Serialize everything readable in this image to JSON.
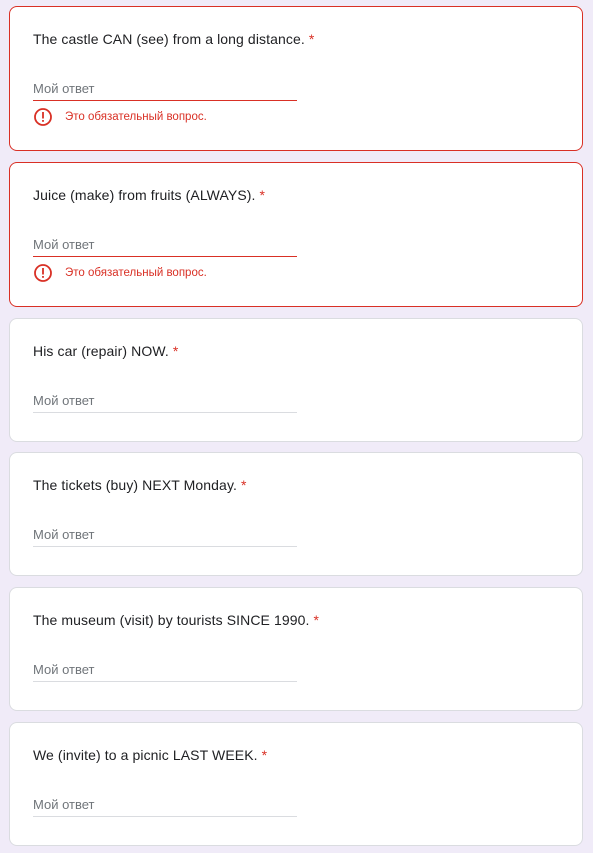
{
  "questions": [
    {
      "title": "The castle CAN (see) from a long distance.",
      "required_mark": "*",
      "placeholder": "Мой ответ",
      "error": "Это обязательный вопрос."
    },
    {
      "title": "Juice (make) from fruits (ALWAYS).",
      "required_mark": "*",
      "placeholder": "Мой ответ",
      "error": "Это обязательный вопрос."
    },
    {
      "title": "His car (repair) NOW.",
      "required_mark": "*",
      "placeholder": "Мой ответ"
    },
    {
      "title": "The tickets (buy) NEXT Monday.",
      "required_mark": "*",
      "placeholder": "Мой ответ"
    },
    {
      "title": "The museum (visit) by tourists SINCE 1990.",
      "required_mark": "*",
      "placeholder": "Мой ответ"
    },
    {
      "title": "We (invite) to a picnic LAST WEEK.",
      "required_mark": "*",
      "placeholder": "Мой ответ"
    }
  ],
  "colors": {
    "background": "#f0ebf8",
    "error": "#d93025",
    "card": "#ffffff",
    "text": "#202124",
    "placeholder": "#70757a"
  },
  "icons": {
    "error": "error-exclamation-circle-icon"
  }
}
